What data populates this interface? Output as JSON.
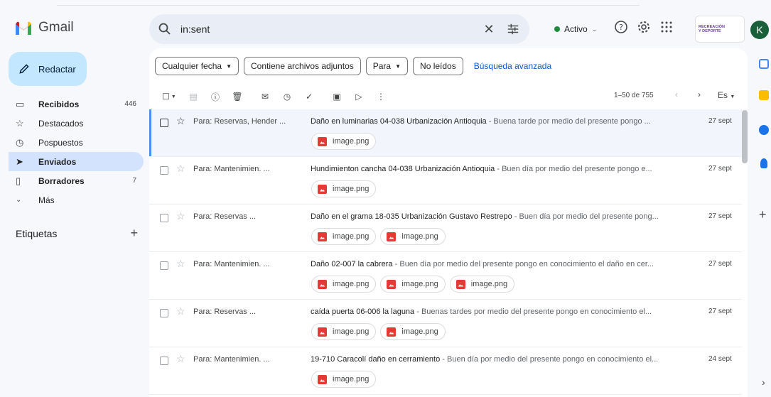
{
  "app": {
    "name": "Gmail"
  },
  "search": {
    "query": "in:sent"
  },
  "status": {
    "label": "Activo"
  },
  "org_badge": {
    "text": "INSTITUTO DISTRITAL DE RECREACIÓN Y DEPORTE",
    "short": "RECREACIÓN Y DEPORTE"
  },
  "avatar": {
    "letter": "K"
  },
  "compose": {
    "label": "Redactar"
  },
  "sidebar": {
    "items": [
      {
        "label": "Recibidos",
        "count": "446",
        "icon": "inbox-icon",
        "bold": true
      },
      {
        "label": "Destacados",
        "count": "",
        "icon": "star-icon",
        "bold": false
      },
      {
        "label": "Pospuestos",
        "count": "",
        "icon": "clock-icon",
        "bold": false
      },
      {
        "label": "Enviados",
        "count": "",
        "icon": "send-icon",
        "bold": true,
        "active": true
      },
      {
        "label": "Borradores",
        "count": "7",
        "icon": "draft-icon",
        "bold": true
      },
      {
        "label": "Más",
        "count": "",
        "icon": "chevron-down-icon",
        "bold": false
      }
    ],
    "labels_header": "Etiquetas"
  },
  "filters": {
    "chips": [
      "Cualquier fecha",
      "Contiene archivos adjuntos",
      "Para",
      "No leídos"
    ],
    "advanced": "Búsqueda avanzada"
  },
  "toolbar": {
    "pager": "1–50 de 755",
    "lang": "Es"
  },
  "emails": [
    {
      "sender": "Para: Reservas, Hender ...",
      "subject": "Daño en luminarias 04-038 Urbanización Antioquia",
      "snippet": " - Buena tarde por medio del presente pongo ...",
      "date": "27 sept",
      "attachments": [
        "image.png"
      ]
    },
    {
      "sender": "Para: Mantenimien. ...",
      "subject": "Hundimienton cancha 04-038 Urbanización Antioquia",
      "snippet": " - Buen día por medio del presente pongo e...",
      "date": "27 sept",
      "attachments": [
        "image.png"
      ]
    },
    {
      "sender": "Para: Reservas ...",
      "subject": "Daño en el grama 18-035 Urbanización Gustavo Restrepo",
      "snippet": " - Buen día por medio del presente pong...",
      "date": "27 sept",
      "attachments": [
        "image.png",
        "image.png"
      ]
    },
    {
      "sender": "Para: Mantenimien. ...",
      "subject": "Daño 02-007 la cabrera",
      "snippet": " - Buen día por medio del presente pongo en conocimiento el daño en cer...",
      "date": "27 sept",
      "attachments": [
        "image.png",
        "image.png",
        "image.png"
      ]
    },
    {
      "sender": "Para: Reservas ...",
      "subject": "caída puerta 06-006 la laguna",
      "snippet": " - Buenas tardes por medio del presente pongo en conocimiento el...",
      "date": "27 sept",
      "attachments": [
        "image.png",
        "image.png"
      ]
    },
    {
      "sender": "Para: Mantenimien. ...",
      "subject": "19-710 Caracolí daño en cerramiento",
      "snippet": " - Buen día por medio del presente pongo en conocimiento el...",
      "date": "24 sept",
      "attachments": [
        "image.png"
      ]
    }
  ],
  "colors": {
    "compose_bg": "#c2e7ff",
    "active_nav": "#d3e3fd",
    "link": "#0b57d0",
    "status_green": "#1e8e3e"
  }
}
